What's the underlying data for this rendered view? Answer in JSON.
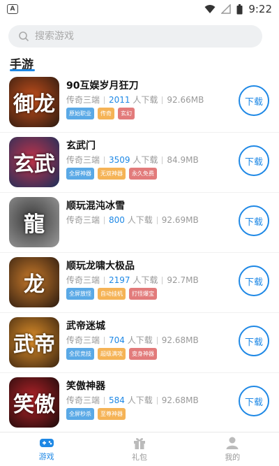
{
  "status": {
    "time": "9:22",
    "left_icon": "a-icon"
  },
  "search": {
    "placeholder": "搜索游戏"
  },
  "section": {
    "title": "手游"
  },
  "games": [
    {
      "name": "90互娱岁月狂刀",
      "category": "传奇三端",
      "downloads": "2011",
      "downloads_suffix": "人下载",
      "size": "92.66MB",
      "icon_text": "御龙",
      "icon_colors": [
        "#2a1a10",
        "#c8501c"
      ],
      "tags": [
        {
          "text": "原始职业",
          "color": "blue"
        },
        {
          "text": "传奇",
          "color": "orange"
        },
        {
          "text": "玄幻",
          "color": "red"
        }
      ]
    },
    {
      "name": "玄武门",
      "category": "传奇三端",
      "downloads": "3509",
      "downloads_suffix": "人下载",
      "size": "84.9MB",
      "icon_text": "玄武",
      "icon_colors": [
        "#1b2f5a",
        "#c2334a"
      ],
      "tags": [
        {
          "text": "全屏神器",
          "color": "blue"
        },
        {
          "text": "无双神器",
          "color": "orange"
        },
        {
          "text": "永久免费",
          "color": "red"
        }
      ]
    },
    {
      "name": "顺玩混沌冰雪",
      "category": "传奇三端",
      "downloads": "800",
      "downloads_suffix": "人下载",
      "size": "92.69MB",
      "icon_text": "龍",
      "icon_colors": [
        "#9a9a9a",
        "#3a3a3a"
      ],
      "tags": []
    },
    {
      "name": "顺玩龙啸大极品",
      "category": "传奇三端",
      "downloads": "2197",
      "downloads_suffix": "人下载",
      "size": "92.7MB",
      "icon_text": "龙",
      "icon_colors": [
        "#2a1a10",
        "#c87a2a"
      ],
      "tags": [
        {
          "text": "全屏放怪",
          "color": "blue"
        },
        {
          "text": "自动挂机",
          "color": "orange"
        },
        {
          "text": "打怪爆宝",
          "color": "red"
        }
      ]
    },
    {
      "name": "武帝迷城",
      "category": "传奇三端",
      "downloads": "704",
      "downloads_suffix": "人下载",
      "size": "92.68MB",
      "icon_text": "武帝",
      "icon_colors": [
        "#3a2410",
        "#e0902a"
      ],
      "tags": [
        {
          "text": "全民竞技",
          "color": "blue"
        },
        {
          "text": "超级满攻",
          "color": "orange"
        },
        {
          "text": "变身神器",
          "color": "red"
        }
      ]
    },
    {
      "name": "笑傲神器",
      "category": "传奇三端",
      "downloads": "584",
      "downloads_suffix": "人下载",
      "size": "92.68MB",
      "icon_text": "笑傲",
      "icon_colors": [
        "#1a0a0a",
        "#b8242a"
      ],
      "tags": [
        {
          "text": "全屏秒杀",
          "color": "blue"
        },
        {
          "text": "至尊神器",
          "color": "orange"
        }
      ]
    }
  ],
  "download_label": "下载",
  "nav": [
    {
      "label": "游戏",
      "icon": "gamepad-icon",
      "active": true
    },
    {
      "label": "礼包",
      "icon": "gift-icon",
      "active": false
    },
    {
      "label": "我的",
      "icon": "user-icon",
      "active": false
    }
  ]
}
